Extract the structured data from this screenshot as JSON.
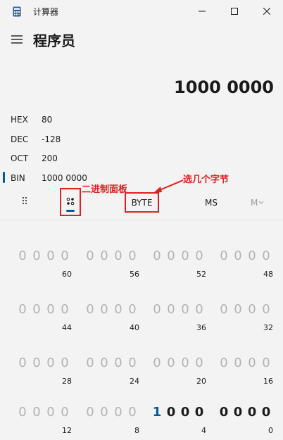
{
  "window": {
    "title": "计算器"
  },
  "header": {
    "mode_title": "程序员"
  },
  "display": {
    "value": "1000 0000"
  },
  "radix": [
    {
      "label": "HEX",
      "value": "80",
      "active": false
    },
    {
      "label": "DEC",
      "value": "-128",
      "active": false
    },
    {
      "label": "OCT",
      "value": "200",
      "active": false
    },
    {
      "label": "BIN",
      "value": "1000 0000",
      "active": true
    }
  ],
  "toolbar": {
    "word_size": "BYTE",
    "memory_store": "MS",
    "memory_recall": "M"
  },
  "annotations": {
    "bitpad_note": "二进制面板",
    "byte_note": "选几个字节"
  },
  "colors": {
    "accent": "#005a9e",
    "annotation": "#e02020",
    "dim_bit": "#b3b3b3"
  },
  "bit_rows": [
    {
      "nibbles": [
        {
          "bits": [
            "0",
            "0",
            "0",
            "0"
          ],
          "pos": "60",
          "on": [
            false,
            false,
            false,
            false
          ]
        },
        {
          "bits": [
            "0",
            "0",
            "0",
            "0"
          ],
          "pos": "56",
          "on": [
            false,
            false,
            false,
            false
          ]
        },
        {
          "bits": [
            "0",
            "0",
            "0",
            "0"
          ],
          "pos": "52",
          "on": [
            false,
            false,
            false,
            false
          ]
        },
        {
          "bits": [
            "0",
            "0",
            "0",
            "0"
          ],
          "pos": "48",
          "on": [
            false,
            false,
            false,
            false
          ]
        }
      ]
    },
    {
      "nibbles": [
        {
          "bits": [
            "0",
            "0",
            "0",
            "0"
          ],
          "pos": "44",
          "on": [
            false,
            false,
            false,
            false
          ]
        },
        {
          "bits": [
            "0",
            "0",
            "0",
            "0"
          ],
          "pos": "40",
          "on": [
            false,
            false,
            false,
            false
          ]
        },
        {
          "bits": [
            "0",
            "0",
            "0",
            "0"
          ],
          "pos": "36",
          "on": [
            false,
            false,
            false,
            false
          ]
        },
        {
          "bits": [
            "0",
            "0",
            "0",
            "0"
          ],
          "pos": "32",
          "on": [
            false,
            false,
            false,
            false
          ]
        }
      ]
    },
    {
      "nibbles": [
        {
          "bits": [
            "0",
            "0",
            "0",
            "0"
          ],
          "pos": "28",
          "on": [
            false,
            false,
            false,
            false
          ]
        },
        {
          "bits": [
            "0",
            "0",
            "0",
            "0"
          ],
          "pos": "24",
          "on": [
            false,
            false,
            false,
            false
          ]
        },
        {
          "bits": [
            "0",
            "0",
            "0",
            "0"
          ],
          "pos": "20",
          "on": [
            false,
            false,
            false,
            false
          ]
        },
        {
          "bits": [
            "0",
            "0",
            "0",
            "0"
          ],
          "pos": "16",
          "on": [
            false,
            false,
            false,
            false
          ]
        }
      ]
    },
    {
      "nibbles": [
        {
          "bits": [
            "0",
            "0",
            "0",
            "0"
          ],
          "pos": "12",
          "on": [
            false,
            false,
            false,
            false
          ]
        },
        {
          "bits": [
            "0",
            "0",
            "0",
            "0"
          ],
          "pos": "8",
          "on": [
            false,
            false,
            false,
            false
          ]
        },
        {
          "bits": [
            "1",
            "0",
            "0",
            "0"
          ],
          "pos": "4",
          "on": [
            true,
            true,
            true,
            true
          ],
          "accent_first": true
        },
        {
          "bits": [
            "0",
            "0",
            "0",
            "0"
          ],
          "pos": "0",
          "on": [
            true,
            true,
            true,
            true
          ]
        }
      ]
    }
  ]
}
